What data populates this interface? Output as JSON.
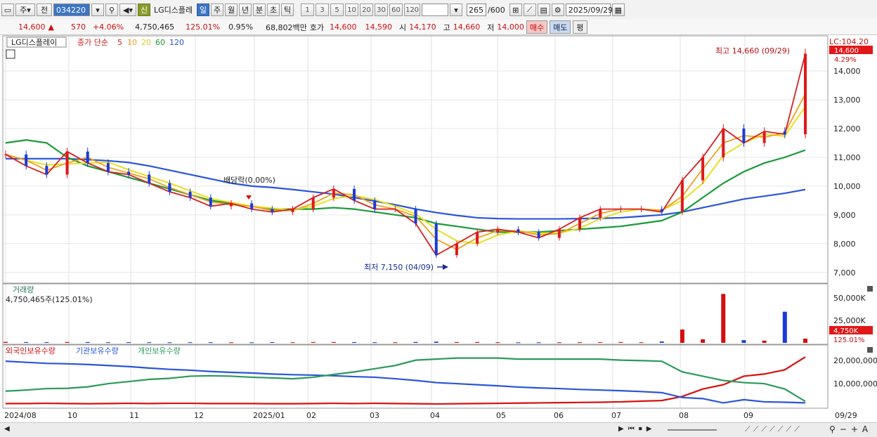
{
  "toolbar": {
    "mode": "주",
    "type": "전",
    "code": "034220",
    "new_badge": "신",
    "name": "LG디스플레",
    "periods": [
      "일",
      "주",
      "월",
      "년",
      "분",
      "초",
      "틱"
    ],
    "minute_options": [
      "1",
      "3",
      "5",
      "10",
      "20",
      "30",
      "60",
      "120"
    ],
    "count": "265",
    "count_total": "/600",
    "date": "2025/09/29"
  },
  "quote": {
    "price": "14,600",
    "change": "570",
    "change_pct": "+4.06%",
    "volume": "4,750,465",
    "volume_ratio": "125.01%",
    "turnover": "0.95%",
    "amount": "68,802백만",
    "ask_label": "호가",
    "ask1": "14,600",
    "ask2": "14,590",
    "open_label": "시",
    "open": "14,170",
    "high_label": "고",
    "high": "14,660",
    "low_label": "저",
    "low": "14,000",
    "buy": "매수",
    "sell": "매도",
    "avg": "평"
  },
  "legend": {
    "name": "LG디스플레이",
    "series": "종가 단순",
    "ma": [
      "5",
      "10",
      "20",
      "60",
      "120"
    ],
    "ma_colors": [
      "#d62020",
      "#f0a020",
      "#e8e020",
      "#1a9a3a",
      "#2a55d8"
    ],
    "lc": "LC:104.20",
    "last_price": "14,600",
    "last_pct": "4.29%"
  },
  "annotations": {
    "high": "최고 14,660 (09/29)",
    "low": "최저 7,150 (04/09)",
    "dividend": "배당락(0.00%)"
  },
  "volume_panel": {
    "title": "거래량",
    "value": "4,750,465주(125.01%)",
    "last": "4,750K",
    "last_pct": "125.01%",
    "ticks": [
      "50,000K",
      "25,000K"
    ]
  },
  "holdings_panel": {
    "series": [
      "외국인보유수량",
      "기관보유수량",
      "개인보유수량"
    ],
    "colors": [
      "#d81010",
      "#2a55d8",
      "#2a9a5a"
    ],
    "ticks": [
      "20,000,000",
      "10,000,000"
    ]
  },
  "x_labels": [
    "2024/08",
    "10",
    "11",
    "12",
    "2025/01",
    "02",
    "03",
    "04",
    "05",
    "06",
    "07",
    "08",
    "09",
    "09/29"
  ],
  "chart_data": {
    "type": "line",
    "price_ticks": [
      "14,000",
      "13,000",
      "12,000",
      "11,000",
      "10,000",
      "9,000",
      "8,000",
      "7,000"
    ],
    "ylim": [
      6750,
      15000
    ],
    "x_month_labels": [
      "2024/08",
      "10",
      "11",
      "12",
      "2025/01",
      "02",
      "03",
      "04",
      "05",
      "06",
      "07",
      "08",
      "09"
    ],
    "series": [
      {
        "name": "종가 (approx)",
        "values": [
          11100,
          10700,
          10400,
          11200,
          10800,
          10500,
          10400,
          10100,
          9800,
          9600,
          9300,
          9400,
          9200,
          9100,
          9200,
          9600,
          9900,
          9500,
          9200,
          9200,
          8700,
          7600,
          8000,
          8400,
          8500,
          8400,
          8200,
          8500,
          8900,
          9200,
          9200,
          9200,
          9100,
          10200,
          11000,
          12000,
          11500,
          11900,
          11800,
          14600
        ]
      },
      {
        "name": "60",
        "values": [
          11500,
          11600,
          11500,
          11000,
          10700,
          10500,
          10300,
          10100,
          9900,
          9700,
          9500,
          9400,
          9300,
          9200,
          9200,
          9200,
          9250,
          9200,
          9100,
          9000,
          8900,
          8700,
          8600,
          8500,
          8400,
          8400,
          8400,
          8450,
          8500,
          8550,
          8600,
          8700,
          8800,
          9100,
          9600,
          10100,
          10500,
          10800,
          11000,
          11250
        ]
      },
      {
        "name": "120",
        "values": [
          10950,
          10950,
          10950,
          10950,
          10920,
          10880,
          10820,
          10700,
          10550,
          10400,
          10250,
          10100,
          10000,
          9950,
          9880,
          9800,
          9720,
          9600,
          9480,
          9350,
          9200,
          9080,
          8980,
          8900,
          8870,
          8860,
          8860,
          8860,
          8870,
          8880,
          8900,
          8950,
          9000,
          9100,
          9250,
          9400,
          9550,
          9650,
          9750,
          9880
        ]
      }
    ],
    "volume_values_k": [
      1100,
      900,
      800,
      1000,
      900,
      700,
      700,
      650,
      600,
      650,
      700,
      600,
      600,
      800,
      700,
      900,
      900,
      850,
      700,
      650,
      1000,
      1300,
      900,
      900,
      700,
      600,
      600,
      600,
      700,
      800,
      900,
      700,
      1500,
      15000,
      4000,
      55000,
      3000,
      2500,
      35000,
      4750
    ],
    "holdings": {
      "외국인보유수량": [
        1200000,
        1200000,
        1300000,
        1200000,
        1100000,
        1200000,
        1300000,
        1200000,
        1300000,
        1300000,
        1200000,
        1200000,
        1200000,
        1100000,
        1100000,
        1200000,
        1300000,
        1200000,
        1300000,
        1200000,
        1100000,
        1000000,
        1100000,
        1200000,
        1300000,
        1400000,
        1500000,
        1600000,
        1700000,
        1800000,
        2000000,
        2300000,
        2600000,
        4500000,
        8000000,
        10000000,
        14000000,
        15000000,
        17000000,
        23000000
      ],
      "기관보유수량": [
        21000000,
        20500000,
        20000000,
        19800000,
        19500000,
        19000000,
        18500000,
        17800000,
        17200000,
        16800000,
        16200000,
        15800000,
        15500000,
        15000000,
        14700000,
        14500000,
        14200000,
        13800000,
        13500000,
        12800000,
        12000000,
        11000000,
        10500000,
        10000000,
        9500000,
        8900000,
        8500000,
        8200000,
        7800000,
        7500000,
        7200000,
        6800000,
        6300000,
        4000000,
        3500000,
        1500000,
        3000000,
        2000000,
        1800000,
        1500000
      ],
      "개인보유수량": [
        7000000,
        7500000,
        8200000,
        8300000,
        9000000,
        10500000,
        11500000,
        12500000,
        13000000,
        14000000,
        14200000,
        14000000,
        13500000,
        13200000,
        12800000,
        13500000,
        14800000,
        16000000,
        17500000,
        19000000,
        21500000,
        22000000,
        22500000,
        22500000,
        22500000,
        22000000,
        22000000,
        22000000,
        22000000,
        22000000,
        21500000,
        21300000,
        21000000,
        16000000,
        14000000,
        12000000,
        11000000,
        10500000,
        8000000,
        2200000
      ]
    }
  }
}
